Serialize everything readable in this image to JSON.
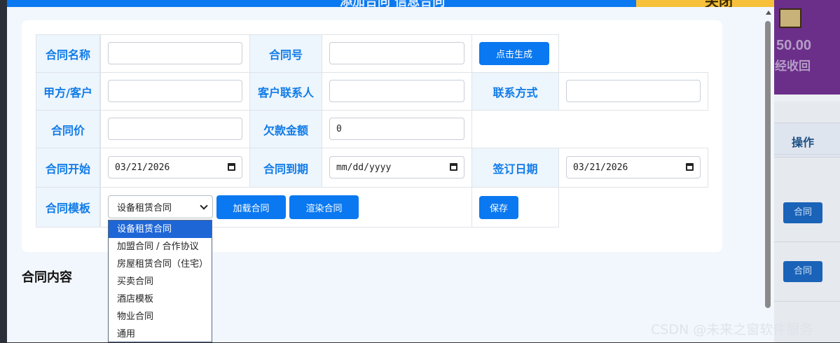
{
  "modal": {
    "title": "添加合同 信息合同",
    "close_label": "关闭"
  },
  "form": {
    "contract_name": {
      "label": "合同名称",
      "value": ""
    },
    "contract_no": {
      "label": "合同号",
      "value": "",
      "generate_button": "点击生成"
    },
    "party_a": {
      "label": "甲方/客户",
      "value": ""
    },
    "client_contact": {
      "label": "客户联系人",
      "value": ""
    },
    "contact_method": {
      "label": "联系方式",
      "value": ""
    },
    "contract_price": {
      "label": "合同价",
      "value": ""
    },
    "arrears": {
      "label": "欠款金额",
      "value": "0"
    },
    "start_date": {
      "label": "合同开始",
      "value": "03/21/2026"
    },
    "end_date": {
      "label": "合同到期",
      "value": "mm/dd/yyyy"
    },
    "sign_date": {
      "label": "签订日期",
      "value": "03/21/2026"
    },
    "template": {
      "label": "合同模板",
      "selected": "设备租赁合同",
      "load_button": "加载合同",
      "render_button": "渲染合同",
      "save_button": "保存",
      "options": [
        "设备租赁合同",
        "加盟合同 / 合作协议",
        "房屋租赁合同（住宅）",
        "买卖合同",
        "酒店模板",
        "物业合同",
        "通用"
      ]
    }
  },
  "content_section_title": "合同内容",
  "background": {
    "amount": "50.00",
    "status": "经收回",
    "column_header": "操作",
    "row_buttons": [
      "合同",
      "合同"
    ]
  },
  "watermark": "CSDN @未来之窗软件服务"
}
